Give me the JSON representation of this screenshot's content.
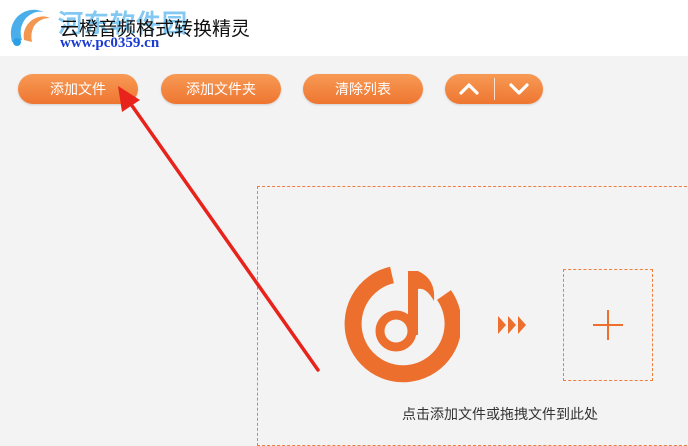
{
  "titlebar": {
    "app_title": "云橙音频格式转换精灵",
    "watermark_name": "河东软件园",
    "watermark_url": "www.pc0359.cn"
  },
  "toolbar": {
    "add_file_label": "添加文件",
    "add_folder_label": "添加文件夹",
    "clear_list_label": "清除列表",
    "move_up_icon": "chevron-up-icon",
    "move_down_icon": "chevron-down-icon"
  },
  "drop_zone": {
    "hint": "点击添加文件或拖拽文件到此处",
    "logo_icon": "music-note-disc-icon",
    "arrows_icon": "triple-forward-arrow-icon",
    "plus_icon": "plus-icon"
  },
  "colors": {
    "accent": "#ee7630",
    "logo": "#ec6f2d",
    "annotation": "#e8231b"
  }
}
